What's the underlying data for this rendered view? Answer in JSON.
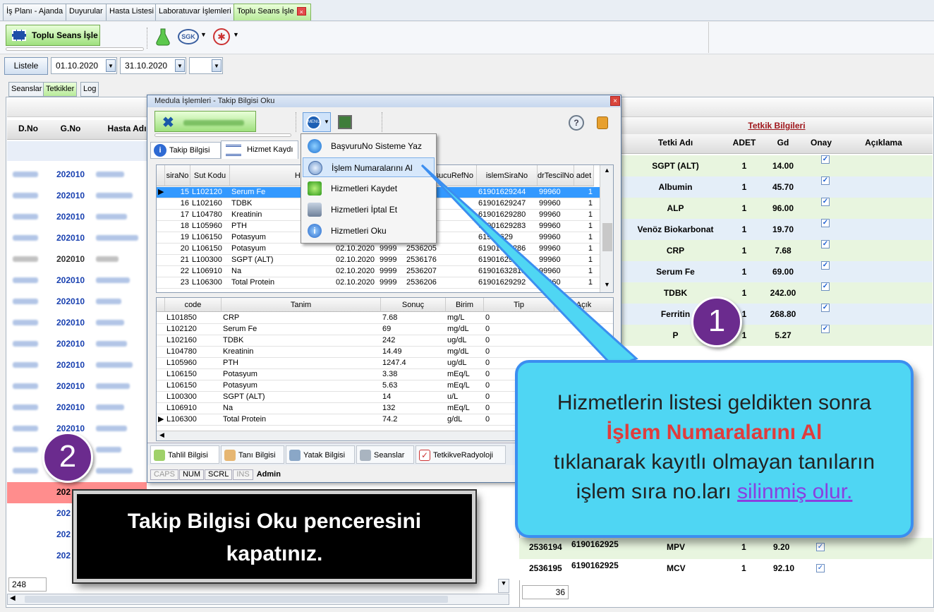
{
  "top_tabs": [
    "İş Planı - Ajanda",
    "Duyurular",
    "Hasta Listesi",
    "Laboratuvar İşlemleri",
    "Toplu Seans İşle"
  ],
  "toolbar": {
    "main_button": "Toplu Seans İşle",
    "sgk_label": "SGK"
  },
  "filter": {
    "list_button": "Listele",
    "date_from": "01.10.2020",
    "date_to": "31.10.2020",
    "extra": ""
  },
  "sub_tabs": [
    "Seanslar",
    "Tetkikler",
    "Log"
  ],
  "left_grid": {
    "headers": [
      "D.No",
      "G.No",
      "Hasta Adı"
    ],
    "gno": [
      "202010",
      "202010",
      "202010",
      "202010",
      "202010",
      "202010",
      "202010",
      "202010",
      "202010",
      "202010",
      "202010",
      "202010",
      "202010",
      "202010",
      "202010",
      "202010",
      "202010",
      "202010",
      "202010"
    ],
    "partial_bottom": [
      "202",
      "202",
      "202",
      "202"
    ],
    "count": "248"
  },
  "right_panel": {
    "title": "Tetkik Bilgileri",
    "headers": [
      "Tetki Adı",
      "ADET",
      "Gd",
      "Onay",
      "Açıklama"
    ],
    "rows": [
      {
        "name": "SGPT (ALT)",
        "adet": "1",
        "gd": "14.00",
        "onay": true
      },
      {
        "name": "Albumin",
        "adet": "1",
        "gd": "45.70",
        "onay": true
      },
      {
        "name": "ALP",
        "adet": "1",
        "gd": "96.00",
        "onay": true
      },
      {
        "name": "Venöz Biokarbonat",
        "adet": "1",
        "gd": "19.70",
        "onay": true
      },
      {
        "name": "CRP",
        "adet": "1",
        "gd": "7.68",
        "onay": true
      },
      {
        "name": "Serum Fe",
        "adet": "1",
        "gd": "69.00",
        "onay": true
      },
      {
        "name": "TDBK",
        "adet": "1",
        "gd": "242.00",
        "onay": true
      },
      {
        "name": "Ferritin",
        "adet": "1",
        "gd": "268.80",
        "onay": true
      },
      {
        "name": "P",
        "adet": "1",
        "gd": "5.27",
        "onay": true
      }
    ],
    "bottom_rows": [
      {
        "ref": "2536194",
        "islem": "6190162925",
        "name": "MPV",
        "adet": "1",
        "gd": "9.20",
        "onay": true
      },
      {
        "ref": "2536195",
        "islem": "6190162925",
        "name": "MCV",
        "adet": "1",
        "gd": "92.10",
        "onay": true
      }
    ],
    "count": "36"
  },
  "dialog": {
    "title": "Medula İşlemleri - Takip Bilgisi Oku",
    "tabs": [
      "Takip Bilgisi",
      "Hizmet Kaydı"
    ],
    "menu_label": "MENU",
    "grid1_headers": [
      "siraNo",
      "Sut Kodu",
      "Hizmet Adı",
      "",
      "",
      "sucuRefNo",
      "islemSiraNo",
      "drTescilNo",
      "adet"
    ],
    "grid1_rows": [
      {
        "sira": "15",
        "sut": "L102120",
        "ad": "Serum Fe",
        "tarih": "",
        "kod": "",
        "ref": "",
        "islem": "61901629244",
        "dr": "99960",
        "adet": "1"
      },
      {
        "sira": "16",
        "sut": "L102160",
        "ad": "TDBK",
        "tarih": "",
        "kod": "",
        "ref": "",
        "islem": "61901629247",
        "dr": "99960",
        "adet": "1"
      },
      {
        "sira": "17",
        "sut": "L104780",
        "ad": "Kreatinin",
        "tarih": "",
        "kod": "",
        "ref": "",
        "islem": "61901629280",
        "dr": "99960",
        "adet": "1"
      },
      {
        "sira": "18",
        "sut": "L105960",
        "ad": "PTH",
        "tarih": "",
        "kod": "",
        "ref": "",
        "islem": "61901629283",
        "dr": "99960",
        "adet": "1"
      },
      {
        "sira": "19",
        "sut": "L106150",
        "ad": "Potasyum",
        "tarih": "",
        "kod": "",
        "ref": "",
        "islem": "61901629",
        "dr": "99960",
        "adet": "1"
      },
      {
        "sira": "20",
        "sut": "L106150",
        "ad": "Potasyum",
        "tarih": "02.10.2020",
        "kod": "9999",
        "ref": "2536205",
        "islem": "61901629286",
        "dr": "99960",
        "adet": "1"
      },
      {
        "sira": "21",
        "sut": "L100300",
        "ad": "SGPT (ALT)",
        "tarih": "02.10.2020",
        "kod": "9999",
        "ref": "2536176",
        "islem": "61901629229",
        "dr": "99960",
        "adet": "1"
      },
      {
        "sira": "22",
        "sut": "L106910",
        "ad": "Na",
        "tarih": "02.10.2020",
        "kod": "9999",
        "ref": "2536207",
        "islem": "61901632813",
        "dr": "99960",
        "adet": "1"
      },
      {
        "sira": "23",
        "sut": "L106300",
        "ad": "Total Protein",
        "tarih": "02.10.2020",
        "kod": "9999",
        "ref": "2536206",
        "islem": "61901629292",
        "dr": "99960",
        "adet": "1"
      }
    ],
    "grid2_headers": [
      "code",
      "Tanim",
      "Sonuç",
      "Birim",
      "Tip",
      "Açık"
    ],
    "grid2_rows": [
      {
        "code": "L101850",
        "tanim": "CRP",
        "sonuc": "7.68",
        "birim": "mg/L",
        "tip": "0"
      },
      {
        "code": "L102120",
        "tanim": "Serum Fe",
        "sonuc": "69",
        "birim": "mg/dL",
        "tip": "0"
      },
      {
        "code": "L102160",
        "tanim": "TDBK",
        "sonuc": "242",
        "birim": "ug/dL",
        "tip": "0"
      },
      {
        "code": "L104780",
        "tanim": "Kreatinin",
        "sonuc": "14.49",
        "birim": "mg/dL",
        "tip": "0"
      },
      {
        "code": "L105960",
        "tanim": "PTH",
        "sonuc": "1247.4",
        "birim": "ug/dL",
        "tip": "0"
      },
      {
        "code": "L106150",
        "tanim": "Potasyum",
        "sonuc": "3.38",
        "birim": "mEq/L",
        "tip": "0"
      },
      {
        "code": "L106150",
        "tanim": "Potasyum",
        "sonuc": "5.63",
        "birim": "mEq/L",
        "tip": "0"
      },
      {
        "code": "L100300",
        "tanim": "SGPT (ALT)",
        "sonuc": "14",
        "birim": "u/L",
        "tip": "0"
      },
      {
        "code": "L106910",
        "tanim": "Na",
        "sonuc": "132",
        "birim": "mEq/L",
        "tip": "0"
      },
      {
        "code": "L106300",
        "tanim": "Total Protein",
        "sonuc": "74.2",
        "birim": "g/dL",
        "tip": "0"
      }
    ],
    "bottom_tabs": [
      "Tahlil Bilgisi",
      "Tanı Bilgisi",
      "Yatak Bilgisi",
      "Seanslar",
      "TetkikveRadyoloji"
    ],
    "status": [
      "CAPS",
      "NUM",
      "SCRL",
      "INS",
      "Admin"
    ]
  },
  "menu_items": [
    "BaşvuruNo Sisteme Yaz",
    "İşlem Numaralarını Al",
    "Hizmetleri Kaydet",
    "Hizmetleri İptal Et",
    "Hizmetleri Oku"
  ],
  "callout": {
    "line1": "Hizmetlerin listesi geldikten sonra",
    "line2": "İşlem Numaralarını Al",
    "line3": "tıklanarak kayıtlı olmayan tanıların",
    "line4_prefix": "işlem sıra no.ları ",
    "line4_link": "silinmiş olur."
  },
  "step1": "1",
  "step2": "2",
  "instruction": {
    "line1": "Takip Bilgisi Oku penceresini",
    "line2": "kapatınız."
  }
}
